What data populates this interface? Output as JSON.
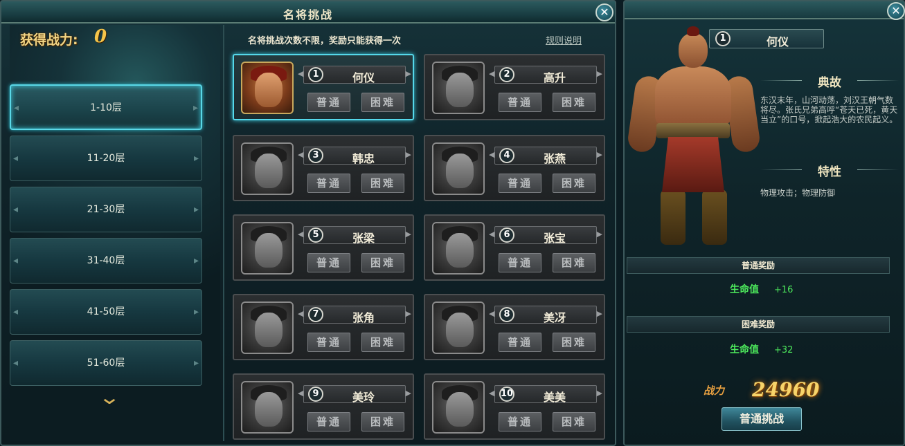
{
  "main_window": {
    "title": "名将挑战",
    "close_label": "✕"
  },
  "left_panel": {
    "power_label": "获得战力:",
    "power_value": "0",
    "floors": [
      {
        "label": "1-10层",
        "active": true
      },
      {
        "label": "11-20层",
        "active": false
      },
      {
        "label": "21-30层",
        "active": false
      },
      {
        "label": "31-40层",
        "active": false
      },
      {
        "label": "41-50层",
        "active": false
      },
      {
        "label": "51-60层",
        "active": false
      }
    ],
    "scroll_icon": "chevron-down-icon"
  },
  "challenge": {
    "notice": "名将挑战次数不限，奖励只能获得一次",
    "rules_link": "规则说明",
    "normal_label": "普通",
    "hard_label": "困难",
    "heroes": [
      {
        "num": "1",
        "name": "何仪"
      },
      {
        "num": "2",
        "name": "高升"
      },
      {
        "num": "3",
        "name": "韩忠"
      },
      {
        "num": "4",
        "name": "张燕"
      },
      {
        "num": "5",
        "name": "张梁"
      },
      {
        "num": "6",
        "name": "张宝"
      },
      {
        "num": "7",
        "name": "张角"
      },
      {
        "num": "8",
        "name": "美冴"
      },
      {
        "num": "9",
        "name": "美玲"
      },
      {
        "num": "10",
        "name": "美美"
      }
    ]
  },
  "detail": {
    "close_label": "✕",
    "hero_num": "1",
    "hero_name": "何仪",
    "story_title": "典故",
    "story_text": "东汉末年，山河动荡，刘汉王朝气数将尽。张氏兄弟高呼“苍天已死，黄天当立”的口号，掀起浩大的农民起义。",
    "trait_title": "特性",
    "trait_text": "物理攻击；物理防御",
    "normal_reward_title": "普通奖励",
    "normal_reward_stat": "生命值",
    "normal_reward_value": "+16",
    "hard_reward_title": "困难奖励",
    "hard_reward_stat": "生命值",
    "hard_reward_value": "+32",
    "combat_label": "战力",
    "combat_value": "24960",
    "challenge_button": "普通挑战"
  },
  "colors": {
    "accent_cyan": "#55d8ea",
    "gold": "#f5c54a",
    "reward_green": "#4dea5c"
  }
}
